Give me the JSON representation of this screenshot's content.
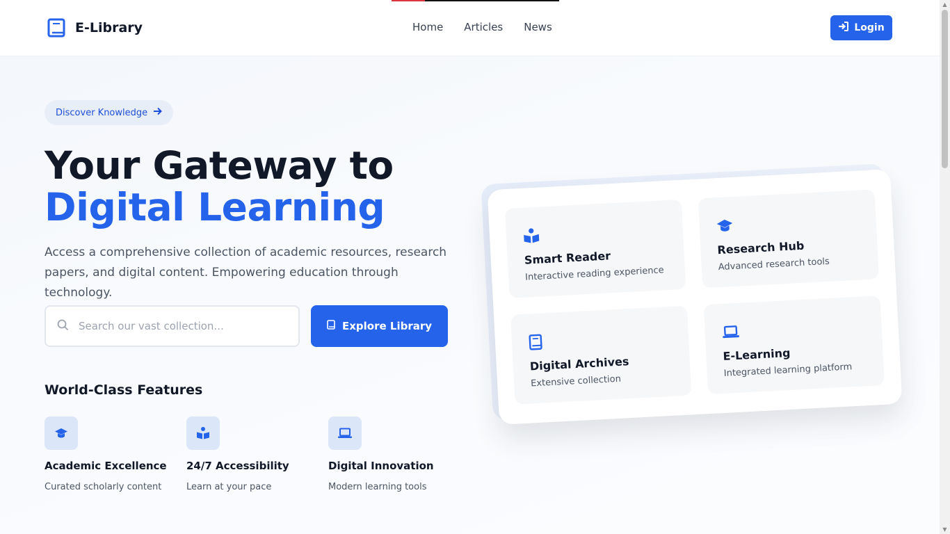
{
  "brand": {
    "name": "E-Library"
  },
  "nav": {
    "items": [
      "Home",
      "Articles",
      "News"
    ]
  },
  "header": {
    "login_label": "Login"
  },
  "hero": {
    "badge": "Discover Knowledge",
    "title_line1": "Your Gateway to",
    "title_line2": "Digital Learning",
    "lead": "Access a comprehensive collection of academic resources, research papers, and digital content. Empowering education through technology.",
    "search_placeholder": "Search our vast collection...",
    "explore_label": "Explore Library"
  },
  "features": {
    "title": "World-Class Features",
    "items": [
      {
        "title": "Academic Excellence",
        "desc": "Curated scholarly content",
        "icon": "graduation-cap-icon"
      },
      {
        "title": "24/7 Accessibility",
        "desc": "Learn at your pace",
        "icon": "book-reader-icon"
      },
      {
        "title": "Digital Innovation",
        "desc": "Modern learning tools",
        "icon": "laptop-icon"
      }
    ]
  },
  "showcase": {
    "tiles": [
      {
        "title": "Smart Reader",
        "desc": "Interactive reading experience",
        "icon": "book-reader-icon"
      },
      {
        "title": "Research Hub",
        "desc": "Advanced research tools",
        "icon": "graduation-cap-icon"
      },
      {
        "title": "Digital Archives",
        "desc": "Extensive collection",
        "icon": "book-icon"
      },
      {
        "title": "E-Learning",
        "desc": "Integrated learning platform",
        "icon": "laptop-icon"
      }
    ]
  },
  "colors": {
    "accent": "#2563eb",
    "text": "#111827",
    "muted": "#4b5563"
  }
}
